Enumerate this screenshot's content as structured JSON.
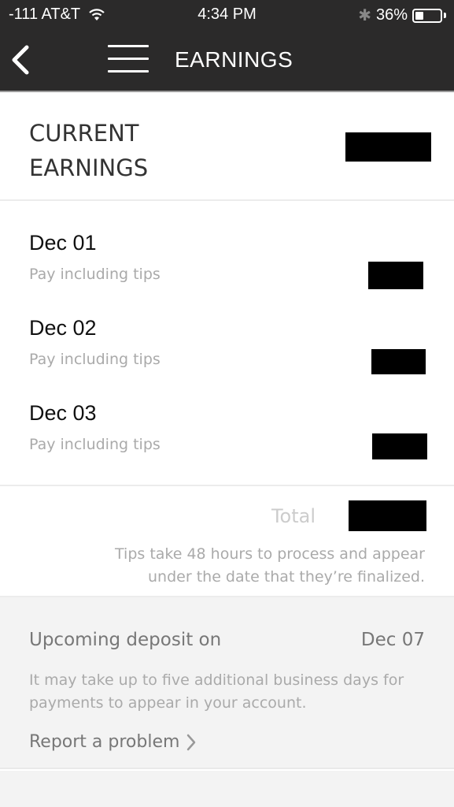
{
  "status_bar": {
    "carrier": "-111 AT&T",
    "time": "4:34 PM",
    "battery_percent_label": "36%",
    "battery_level": 0.36
  },
  "nav": {
    "title": "EARNINGS"
  },
  "current_earnings": {
    "label_line1": "CURRENT",
    "label_line2": "EARNINGS",
    "amount": "[redacted]"
  },
  "days": [
    {
      "date": "Dec 01",
      "subtitle": "Pay including tips",
      "amount": "[redacted]"
    },
    {
      "date": "Dec 02",
      "subtitle": "Pay including tips",
      "amount": "[redacted]"
    },
    {
      "date": "Dec 03",
      "subtitle": "Pay including tips",
      "amount": "[redacted]"
    }
  ],
  "totals": {
    "label": "Total",
    "amount": "[redacted]",
    "tips_note": "Tips take 48 hours to process and appear under the date that they’re finalized."
  },
  "deposit": {
    "label": "Upcoming deposit on",
    "date": "Dec 07",
    "note": "It may take up to five additional business days for payments to appear in your account.",
    "report_link": "Report a problem"
  }
}
